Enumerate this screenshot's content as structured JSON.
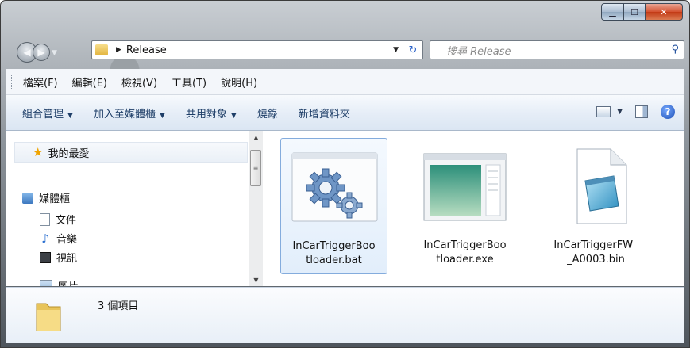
{
  "address": {
    "crumb": "Release"
  },
  "search": {
    "placeholder": "搜尋 Release"
  },
  "menu": [
    "檔案(F)",
    "編輯(E)",
    "檢視(V)",
    "工具(T)",
    "說明(H)"
  ],
  "commands": {
    "organize": "組合管理",
    "include": "加入至媒體櫃",
    "share": "共用對象",
    "burn": "燒錄",
    "new_folder": "新增資料夾"
  },
  "nav": {
    "favorites": "我的最愛",
    "libraries": "媒體櫃",
    "documents": "文件",
    "music": "音樂",
    "videos": "視訊",
    "pictures": "圖片"
  },
  "files": [
    {
      "line1": "InCarTriggerBoo",
      "line2": "tloader.bat",
      "icon": "gears-icon"
    },
    {
      "line1": "InCarTriggerBoo",
      "line2": "tloader.exe",
      "icon": "application-window-icon"
    },
    {
      "line1": "InCarTriggerFW_",
      "line2": "_A0003.bin",
      "icon": "notepad-icon"
    }
  ],
  "status": {
    "count": "3 個項目"
  }
}
